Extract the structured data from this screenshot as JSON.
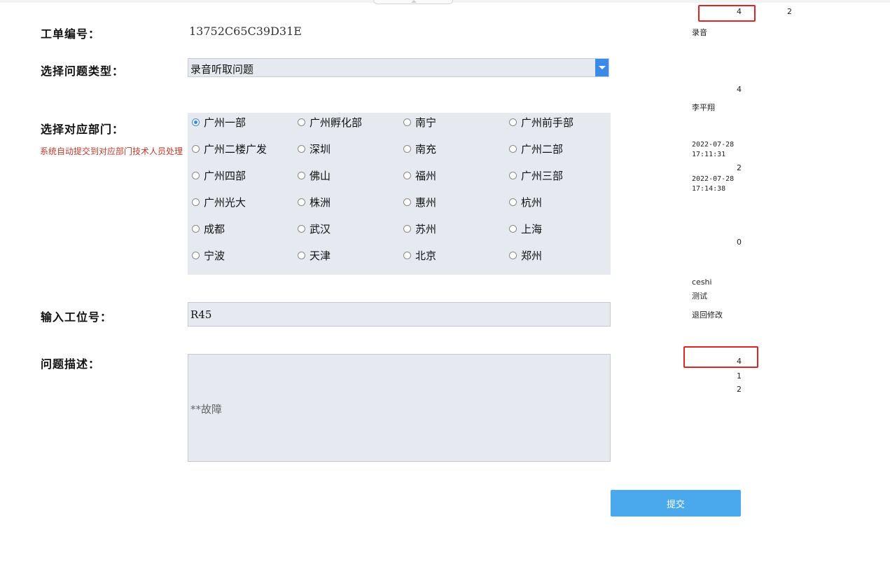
{
  "form": {
    "order_no_label": "工单编号：",
    "order_no": "13752C65C39D31E",
    "issue_type_label": "选择问题类型：",
    "issue_type_value": "录音听取问题",
    "department_label": "选择对应部门：",
    "department_hint": "系统自动提交到对应部门技术人员处理",
    "departments": [
      {
        "label": "广州一部",
        "checked": true
      },
      {
        "label": "广州孵化部",
        "checked": false
      },
      {
        "label": "南宁",
        "checked": false
      },
      {
        "label": "广州前手部",
        "checked": false
      },
      {
        "label": "广州二楼广发",
        "checked": false
      },
      {
        "label": "深圳",
        "checked": false
      },
      {
        "label": "南充",
        "checked": false
      },
      {
        "label": "广州二部",
        "checked": false
      },
      {
        "label": "广州四部",
        "checked": false
      },
      {
        "label": "佛山",
        "checked": false
      },
      {
        "label": "福州",
        "checked": false
      },
      {
        "label": "广州三部",
        "checked": false
      },
      {
        "label": "广州光大",
        "checked": false
      },
      {
        "label": "株洲",
        "checked": false
      },
      {
        "label": "惠州",
        "checked": false
      },
      {
        "label": "杭州",
        "checked": false
      },
      {
        "label": "成都",
        "checked": false
      },
      {
        "label": "武汉",
        "checked": false
      },
      {
        "label": "苏州",
        "checked": false
      },
      {
        "label": "上海",
        "checked": false
      },
      {
        "label": "宁波",
        "checked": false
      },
      {
        "label": "天津",
        "checked": false
      },
      {
        "label": "北京",
        "checked": false
      },
      {
        "label": "郑州",
        "checked": false
      }
    ],
    "station_label": "输入工位号：",
    "station_value": "R45",
    "description_label": "问题描述：",
    "description_value": "**故障",
    "submit_label": "提交"
  },
  "side_panel": {
    "v1": "4",
    "v2": "2",
    "text1": "录音",
    "v3": "4",
    "name": "李平翔",
    "date1": "2022-07-28",
    "time1": "17:11:31",
    "v4": "2",
    "date2": "2022-07-28",
    "time2": "17:14:38",
    "v5": "0",
    "user": "ceshi",
    "test": "测试",
    "action": "退回修改",
    "v6": "4",
    "v7": "1",
    "v8": "2"
  },
  "colors": {
    "accent": "#4aa8ec",
    "select_arrow": "#3a8be8",
    "hint": "#c0392b",
    "field_bg": "#e6e9f0",
    "highlight_box": "#e32222"
  }
}
